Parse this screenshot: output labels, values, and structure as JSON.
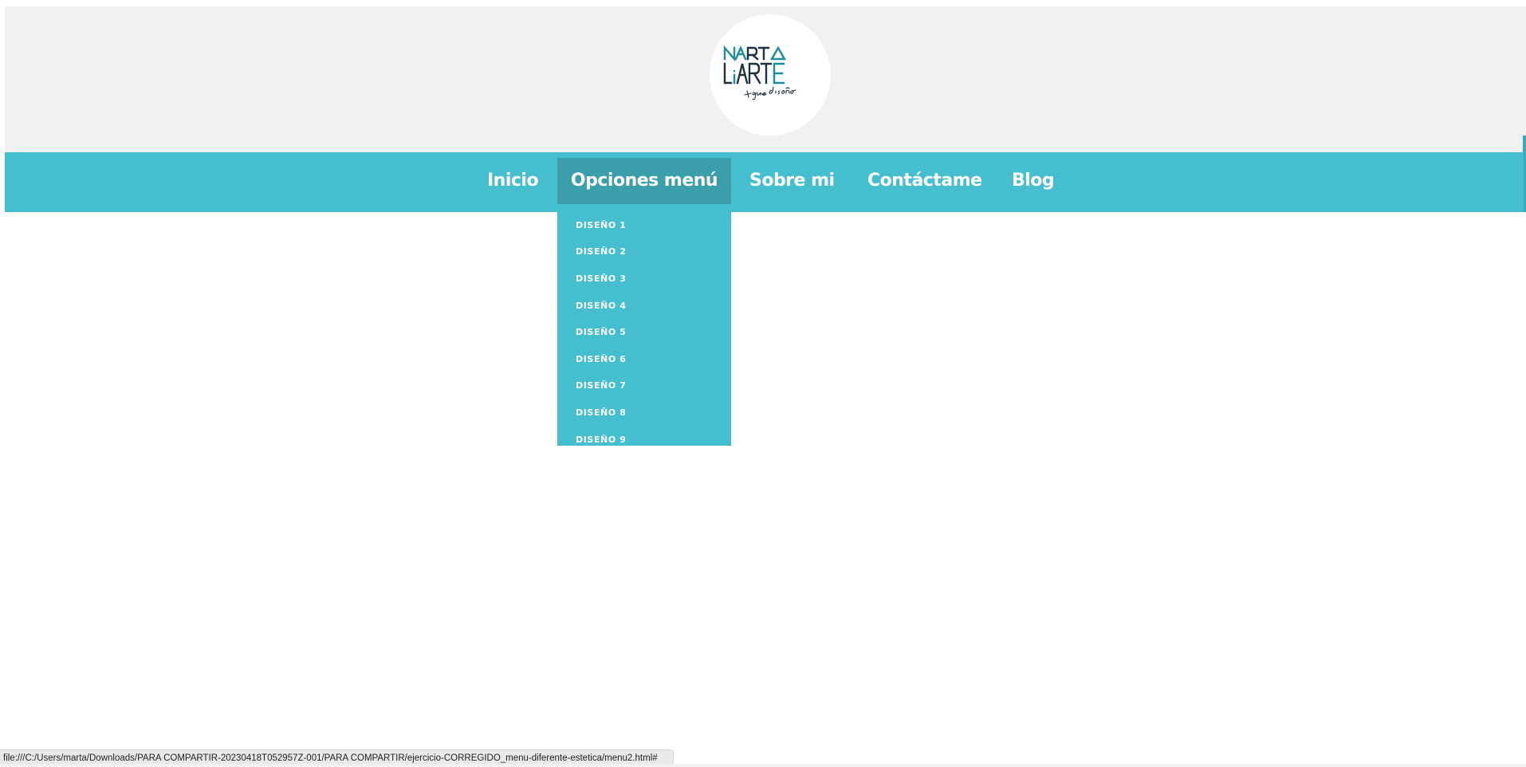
{
  "header": {
    "logo": {
      "text_line1_left": "MARTA",
      "text_line2": "LiARTE",
      "tagline": "+ que diseño",
      "brand_color": "#1a8f9b",
      "dark_color": "#1e3140"
    }
  },
  "nav": {
    "items": [
      {
        "label": "Inicio"
      },
      {
        "label": "Opciones menú"
      },
      {
        "label": "Sobre mi"
      },
      {
        "label": "Contáctame"
      },
      {
        "label": "Blog"
      }
    ],
    "active_index": 1,
    "bg_color": "#45bfcf",
    "active_bg_color": "#3a9faa"
  },
  "dropdown": {
    "items": [
      {
        "label": "DISEÑO 1"
      },
      {
        "label": "DISEÑO 2"
      },
      {
        "label": "DISEÑO 3"
      },
      {
        "label": "DISEÑO 4"
      },
      {
        "label": "DISEÑO 5"
      },
      {
        "label": "DISEÑO 6"
      },
      {
        "label": "DISEÑO 7"
      },
      {
        "label": "DISEÑO 8"
      },
      {
        "label": "DISEÑO 9"
      }
    ]
  },
  "status_bar": {
    "url": "file:///C:/Users/marta/Downloads/PARA COMPARTIR-20230418T052957Z-001/PARA COMPARTIR/ejercicio-CORREGIDO_menu-diferente-estetica/menu2.html#"
  }
}
